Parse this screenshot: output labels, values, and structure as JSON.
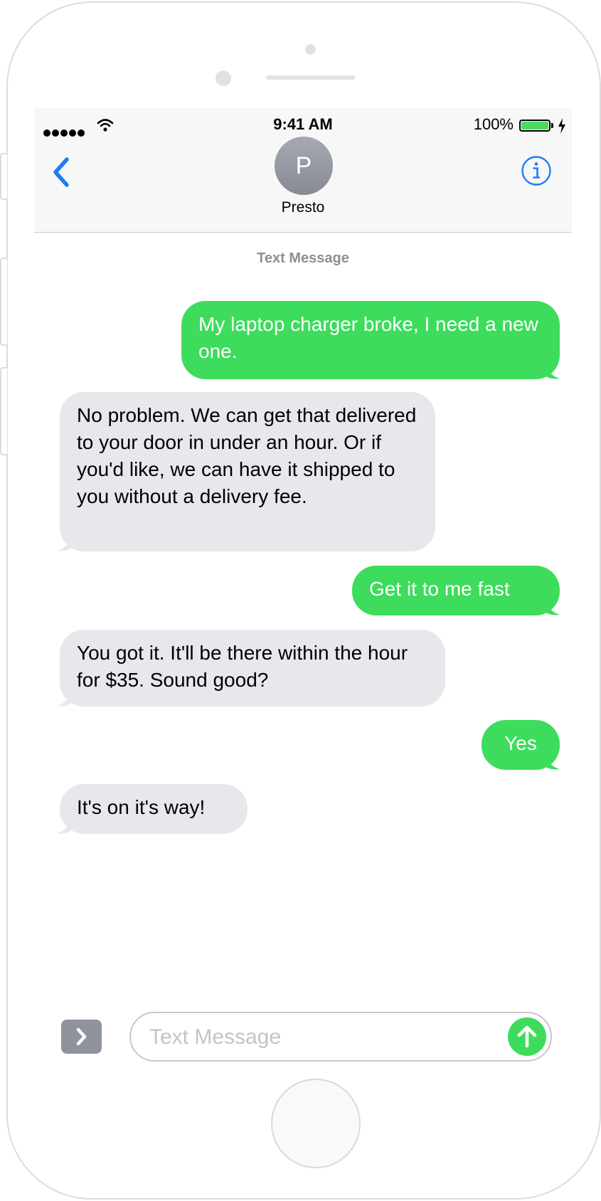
{
  "status_bar": {
    "time": "9:41 AM",
    "battery_percent": "100%",
    "battery_level": 1.0,
    "signal_bars": 5
  },
  "header": {
    "avatar_initial": "P",
    "contact_name": "Presto",
    "back_icon": "chevron-left-icon",
    "info_icon": "info-icon"
  },
  "thread": {
    "label": "Text Message",
    "messages": [
      {
        "direction": "sent",
        "text": "My laptop charger broke, I need a new one."
      },
      {
        "direction": "received",
        "text": "No problem. We can get that delivered to your door in under an hour. Or if you'd like, we can have it shipped to you without a delivery fee."
      },
      {
        "direction": "sent",
        "text": "Get it to me fast"
      },
      {
        "direction": "received",
        "text": "You got it. It'll be there within the hour for $35. Sound good?"
      },
      {
        "direction": "sent",
        "text": "Yes"
      },
      {
        "direction": "received",
        "text": "It's on it's way!"
      }
    ]
  },
  "composer": {
    "placeholder": "Text Message",
    "value": "",
    "apps_icon": "chevron-right-icon",
    "send_icon": "arrow-up-icon"
  },
  "colors": {
    "sent_bubble": "#3ddc5c",
    "received_bubble": "#e8e8ec",
    "accent_blue": "#1a7ef5",
    "battery_fill": "#4cd964"
  }
}
